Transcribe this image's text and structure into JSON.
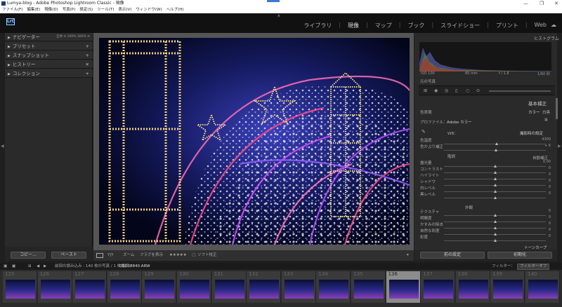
{
  "window": {
    "title": "Lumya-blog - Adobe Photoshop Lightroom Classic - 現像",
    "controls": [
      "—",
      "❐",
      "✕"
    ]
  },
  "menubar": [
    "ファイル(F)",
    "編集(E)",
    "現像(D)",
    "写真(P)",
    "設定(S)",
    "ツール(T)",
    "表示(V)",
    "ウィンドウ(W)",
    "ヘルプ(H)"
  ],
  "app": {
    "logo": "LrC",
    "modules": [
      "ライブラリ",
      "現像",
      "マップ",
      "ブック",
      "スライドショー",
      "プリント",
      "Web"
    ],
    "active_module": "現像"
  },
  "left_panel": {
    "sections": [
      {
        "label": "ナビゲーター",
        "extra": "全体 ≡  100%  300% ≡"
      },
      {
        "label": "プリセット",
        "extra": "+"
      },
      {
        "label": "スナップショット",
        "extra": "+"
      },
      {
        "label": "ヒストリー",
        "extra": "✕"
      },
      {
        "label": "コレクション",
        "extra": "+"
      }
    ],
    "copy_button": "コピー...",
    "paste_button": "ペースト"
  },
  "toolbar": {
    "zoom_label": "ズーム",
    "before_after": "Y|Y",
    "flag_label": "フラグを表示",
    "rating": "★★★★★",
    "soft_proof": "ソフト校正",
    "checkbox": "□"
  },
  "right_panel": {
    "histogram_title": "ヒストグラム",
    "hist_readout": [
      "ISO 100",
      "85 mm",
      "f / 1.8",
      "1/60 秒"
    ],
    "original_photo": "元の写真",
    "basic_title": "基本補正",
    "treatment_label": "色表現",
    "treatment_options": [
      "カラー",
      "白黒"
    ],
    "profile_label": "プロファイル：",
    "profile_value": "Adobe カラー",
    "wb_label": "WB：",
    "wb_value": "撮影時の設定",
    "sliders_wb": [
      {
        "label": "色温度",
        "value": "4300",
        "pos": 0.52
      },
      {
        "label": "色かぶり補正",
        "value": "+ 6",
        "pos": 0.51
      }
    ],
    "tone_label": "階調",
    "auto_label": "自動補正",
    "sliders_tone": [
      {
        "label": "露光量",
        "value": "0.00",
        "pos": 0.5
      },
      {
        "label": "コントラスト",
        "value": "0",
        "pos": 0.5
      },
      {
        "label": "ハイライト",
        "value": "0",
        "pos": 0.5
      },
      {
        "label": "シャドウ",
        "value": "0",
        "pos": 0.5
      },
      {
        "label": "白レベル",
        "value": "0",
        "pos": 0.5
      },
      {
        "label": "黒レベル",
        "value": "0",
        "pos": 0.5
      }
    ],
    "presence_label": "外観",
    "sliders_presence": [
      {
        "label": "テクスチャ",
        "value": "0",
        "pos": 0.5
      },
      {
        "label": "明瞭度",
        "value": "0",
        "pos": 0.5
      },
      {
        "label": "かすみの除去",
        "value": "0",
        "pos": 0.5
      },
      {
        "label": "自然な彩度",
        "value": "0",
        "pos": 0.5
      },
      {
        "label": "彩度",
        "value": "0",
        "pos": 0.5
      }
    ],
    "tone_curve_title": "トーンカーブ",
    "prev_button": "前の設定",
    "reset_button": "初期化"
  },
  "filmstrip": {
    "header_prefix": "前回の読み込み : 140 枚の写真 / 1 枚選択 /",
    "filename": "DSC08840.ARW",
    "filter_label": "フィルター：",
    "filter_value": "フィルターオフ",
    "numbers": [
      "125",
      "126",
      "127",
      "128",
      "129",
      "130",
      "131",
      "132",
      "133",
      "134",
      "135",
      "136",
      "137",
      "138",
      "139",
      "140"
    ],
    "selected": "136"
  }
}
